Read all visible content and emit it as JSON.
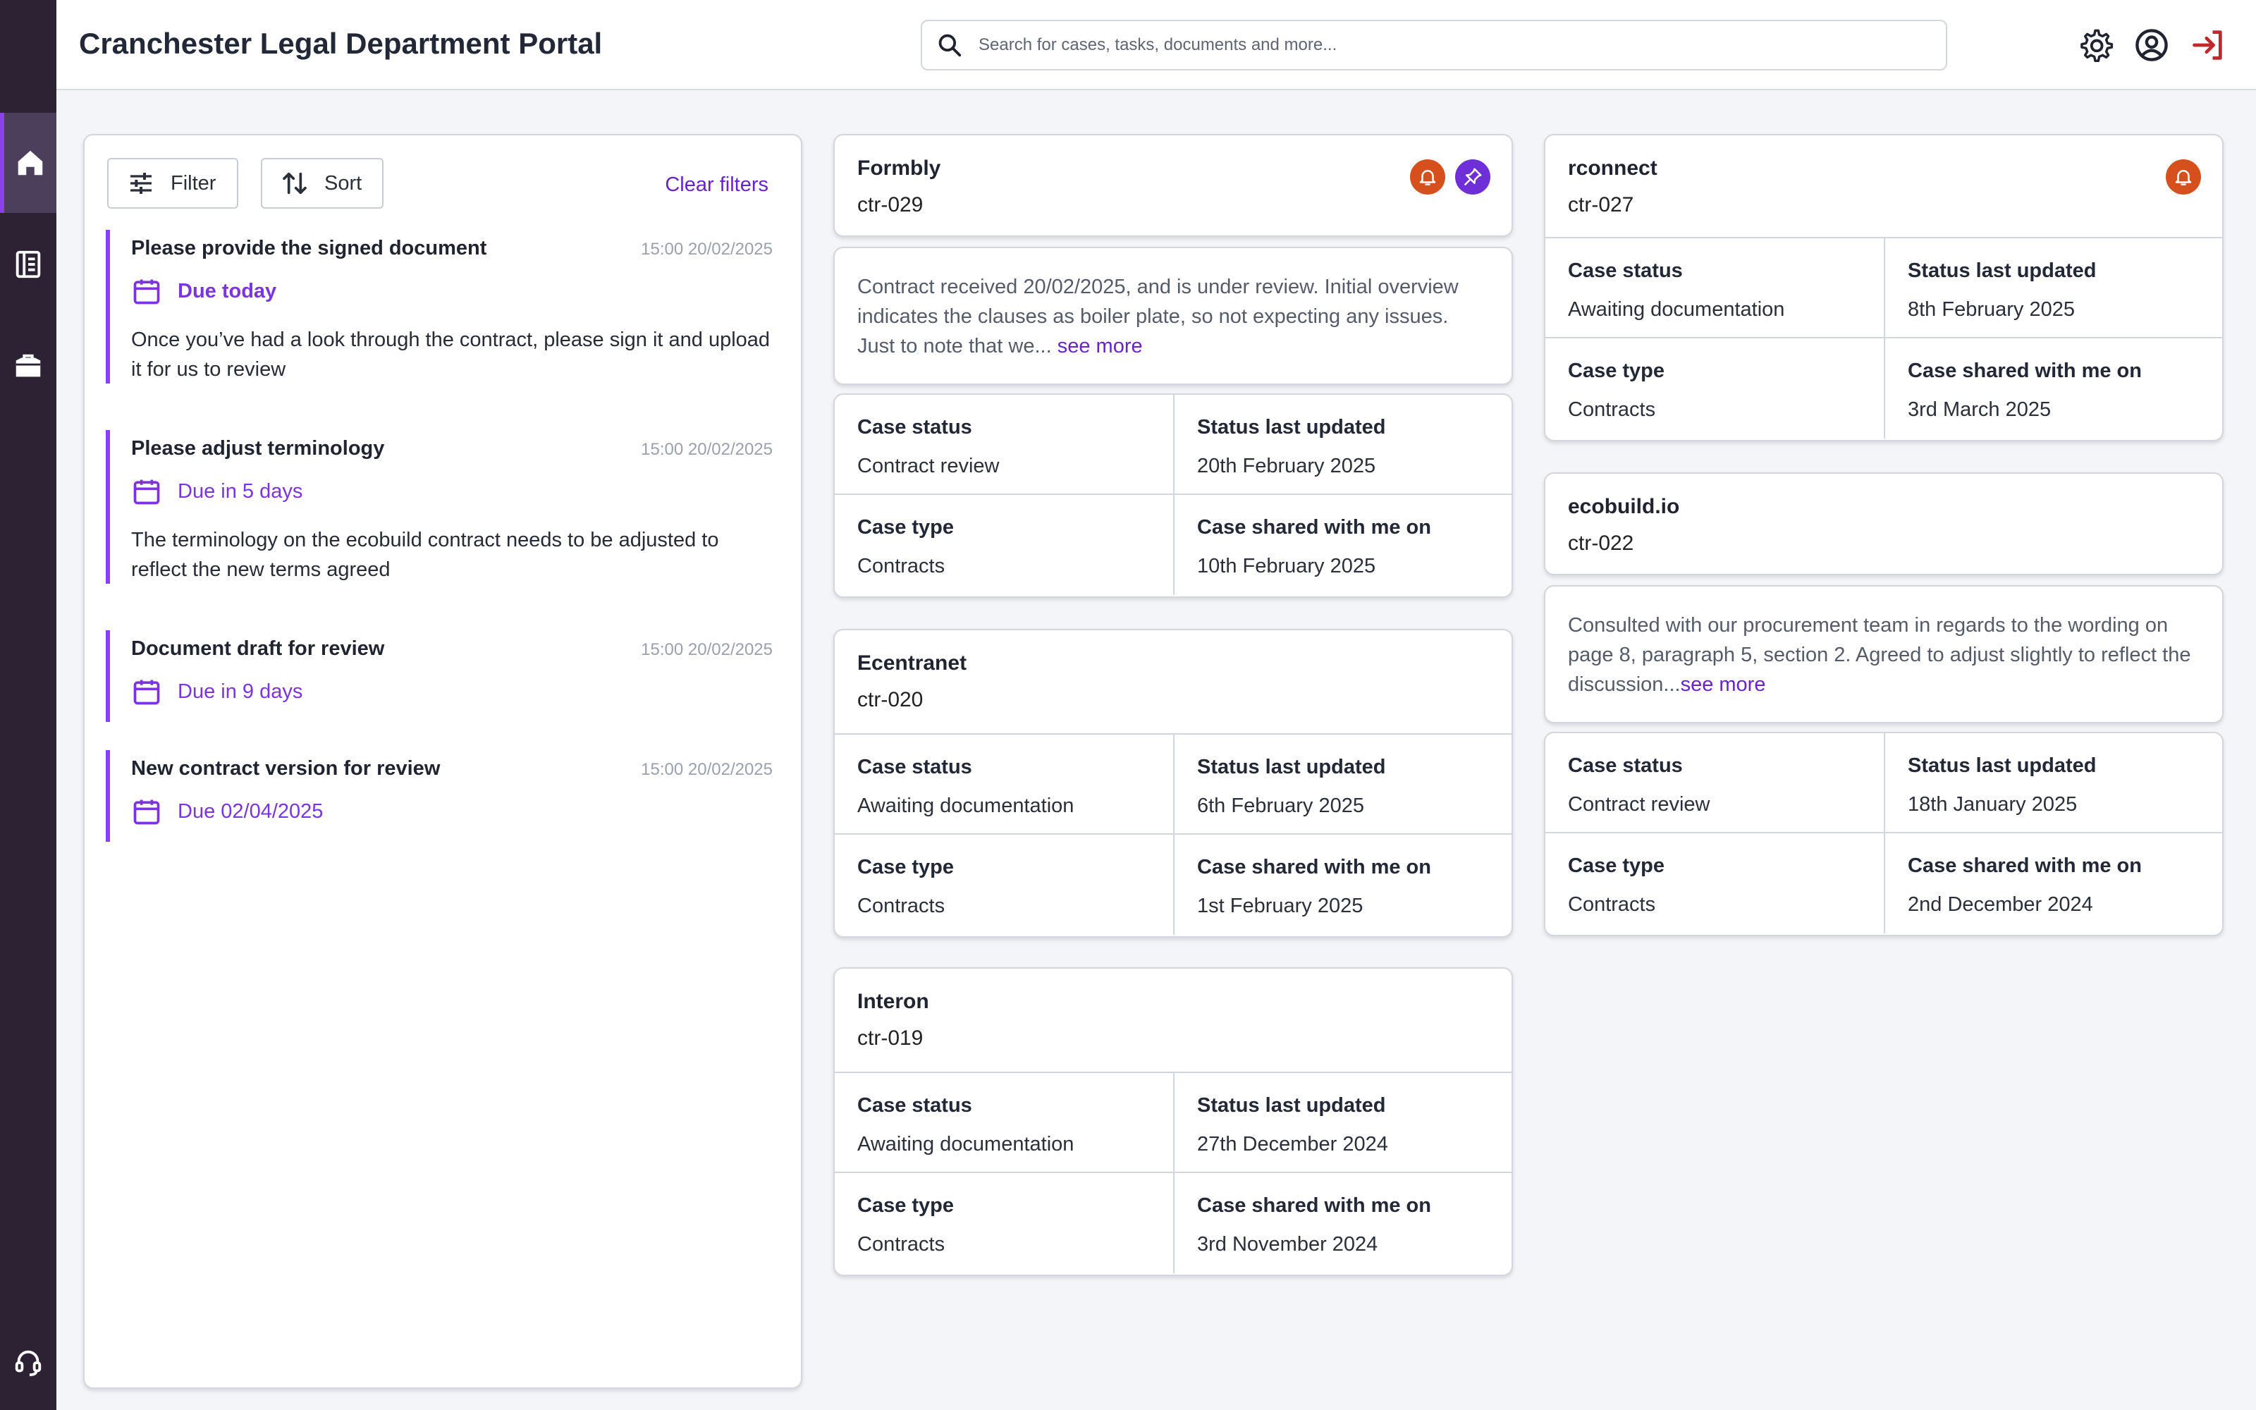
{
  "header": {
    "title": "Cranchester Legal Department Portal",
    "search_placeholder": "Search for cases, tasks, documents and more..."
  },
  "rail": {
    "items": [
      {
        "icon": "home-icon",
        "active": true
      },
      {
        "icon": "document-list-icon",
        "active": false
      },
      {
        "icon": "briefcase-icon",
        "active": false
      }
    ],
    "footer_icon": "headset-icon"
  },
  "toolbar": {
    "filter_label": "Filter",
    "sort_label": "Sort",
    "clear_label": "Clear filters"
  },
  "tasks": [
    {
      "title": "Please provide the signed document",
      "time": "15:00 20/02/2025",
      "due": "Due today",
      "description": "Once you’ve had a look through the contract, please sign it and upload it for us to review"
    },
    {
      "title": "Please adjust terminology",
      "time": "15:00 20/02/2025",
      "due": "Due in 5 days",
      "description": "The terminology on the ecobuild contract needs to be adjusted to reflect the new terms agreed"
    },
    {
      "title": "Document draft for review",
      "time": "15:00 20/02/2025",
      "due": "Due in 9 days",
      "description": ""
    },
    {
      "title": "New contract version for review",
      "time": "15:00 20/02/2025",
      "due": "Due 02/04/2025",
      "description": ""
    }
  ],
  "field_labels": {
    "status": "Case status",
    "updated": "Status last updated",
    "type": "Case type",
    "shared": "Case shared with me on"
  },
  "cases": {
    "formbly": {
      "company": "Formbly",
      "ref": "ctr-029",
      "note": "Contract received 20/02/2025, and is under review. Initial overview indicates the clauses as boiler plate, so not expecting any issues. Just to note that we...",
      "note_more": "see more",
      "status": "Contract review",
      "updated": "20th February 2025",
      "type": "Contracts",
      "shared": "10th February 2025"
    },
    "ecentranet": {
      "company": "Ecentranet",
      "ref": "ctr-020",
      "status": "Awaiting documentation",
      "updated": "6th February 2025",
      "type": "Contracts",
      "shared": "1st February 2025"
    },
    "interon": {
      "company": "Interon",
      "ref": "ctr-019",
      "status": "Awaiting documentation",
      "updated": "27th December 2024",
      "type": "Contracts",
      "shared": "3rd November 2024"
    },
    "rconnect": {
      "company": "rconnect",
      "ref": "ctr-027",
      "status": "Awaiting documentation",
      "updated": "8th February 2025",
      "type": "Contracts",
      "shared": "3rd March 2025"
    },
    "ecobuild": {
      "company": "ecobuild.io",
      "ref": "ctr-022",
      "note": "Consulted with our procurement team in regards to the wording on page 8, paragraph 5, section 2. Agreed to adjust slightly to reflect the discussion...",
      "note_more": "see more",
      "status": "Contract review",
      "updated": "18th January 2025",
      "type": "Contracts",
      "shared": "2nd December 2024"
    }
  },
  "colors": {
    "accent": "#7c33e0",
    "rail": "#2c2233",
    "alert": "#d5501c",
    "pin": "#6e2ed8",
    "logout": "#c0292b"
  }
}
